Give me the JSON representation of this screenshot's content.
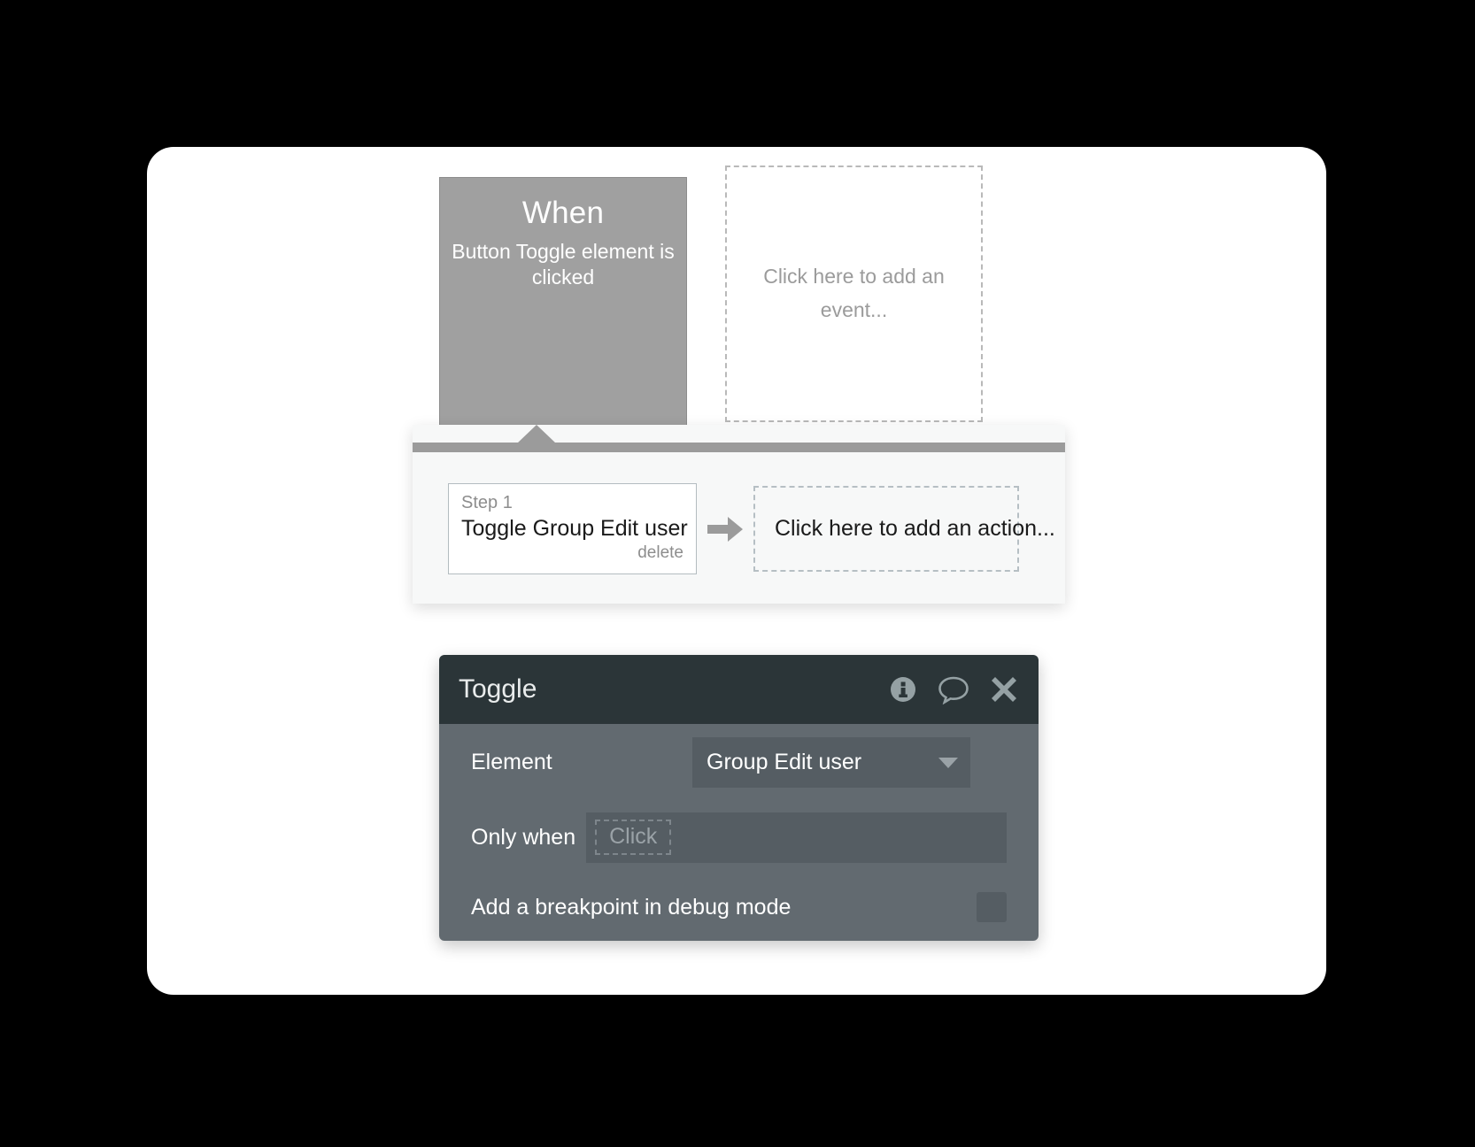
{
  "canvas": {
    "background_color": "#000000",
    "card_background": "#ffffff"
  },
  "workflow": {
    "event_block": {
      "title": "When",
      "description": "Button Toggle element is clicked",
      "background_color": "#a0a0a0"
    },
    "add_event_placeholder": "Click here to add an event...",
    "actions_panel": {
      "steps": [
        {
          "label": "Step 1",
          "title": "Toggle Group Edit user",
          "delete_label": "delete"
        }
      ],
      "arrow_icon": "arrow-right-icon",
      "add_action_placeholder": "Click here to add an action..."
    }
  },
  "properties_panel": {
    "title": "Toggle",
    "header_icons": [
      {
        "name": "info-icon"
      },
      {
        "name": "comment-icon"
      },
      {
        "name": "close-icon"
      }
    ],
    "rows": {
      "element": {
        "label": "Element",
        "value": "Group Edit user",
        "dropdown_icon": "chevron-down-icon"
      },
      "only_when": {
        "label": "Only when",
        "placeholder": "Click"
      },
      "breakpoint": {
        "label": "Add a breakpoint in debug mode",
        "checked": false
      }
    },
    "colors": {
      "header": "#2b3538",
      "body": "#626a70",
      "field": "#555d63"
    }
  }
}
